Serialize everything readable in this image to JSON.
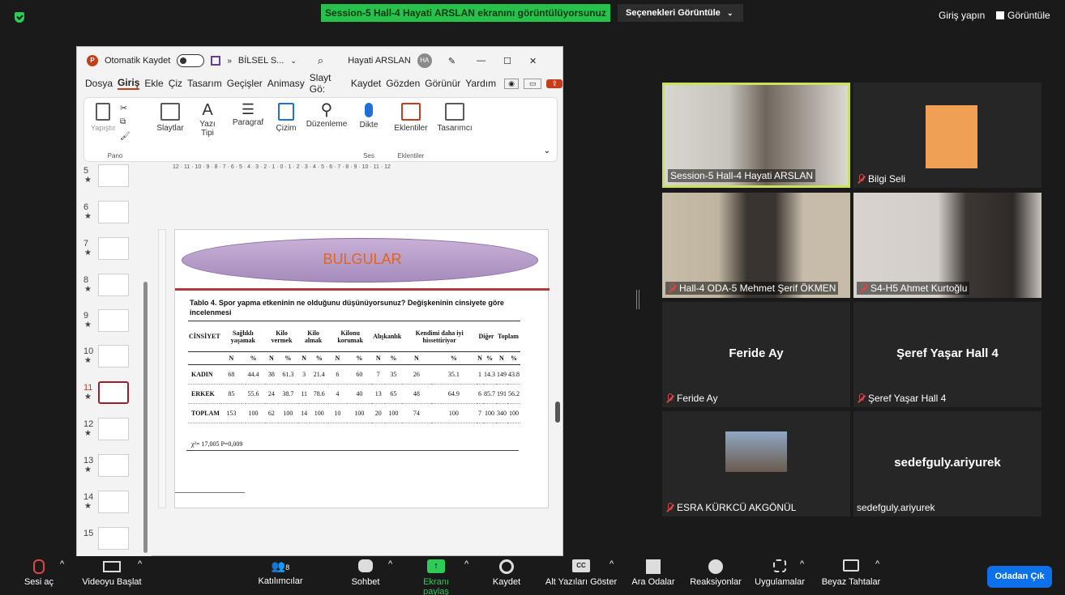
{
  "top": {
    "share_banner": "Session-5 Hall-4 Hayati ARSLAN  ekranını görüntülüyorsunuz",
    "options": "Seçenekleri Görüntüle",
    "signin": "Giriş yapın",
    "view": "Görüntüle"
  },
  "ppt": {
    "autosave": "Otomatik Kaydet",
    "filename": "BİLSEL S...",
    "user": "Hayati ARSLAN",
    "user_initials": "HA",
    "menu": [
      "Dosya",
      "Giriş",
      "Ekle",
      "Çiz",
      "Tasarım",
      "Geçişler",
      "Animasy",
      "Slayt Gö:",
      "Kaydet",
      "Gözden",
      "Görünür",
      "Yardım"
    ],
    "ribbon": {
      "paste": "Yapıştır",
      "clipboard_group": "Pano",
      "slides": "Slaytlar",
      "font": "Yazı Tipi",
      "paragraph": "Paragraf",
      "drawing": "Çizim",
      "editing": "Düzenleme",
      "dictate": "Dikte",
      "voice_group": "Ses",
      "addins": "Eklentiler",
      "addins_group": "Eklentiler",
      "designer": "Tasarımcı"
    },
    "thumbnail_numbers": [
      "5",
      "6",
      "7",
      "8",
      "9",
      "10",
      "11",
      "12",
      "13",
      "14",
      "15"
    ],
    "ruler": "12 · 11 · 10 · 9 · 8 · 7 · 6 · 5 · 4 · 3 · 2 · 1 · 0 · 1 · 2 · 3 · 4 · 5 · 6 · 7 · 8 · 9 · 10 · 11 · 12"
  },
  "slide": {
    "heading": "BULGULAR",
    "table_title": "Tablo 4. Spor yapma etkeninin ne olduğunu düşünüyorsunuz? Değişkeninin cinsiyete göre incelenmesi",
    "col_main": "CİNSİYET",
    "groups": [
      "Sağlıklı yaşamak",
      "Kilo vermek",
      "Kilo almak",
      "Kilonu korumak",
      "Alışkanlık",
      "Kendimi daha iyi hissettiriyor",
      "Diğer",
      "Toplam"
    ],
    "sub": [
      "N",
      "%",
      "N",
      "%",
      "N",
      "%",
      "N",
      "%",
      "N",
      "%",
      "N",
      "%",
      "N",
      "%",
      "N",
      "%"
    ],
    "rows": [
      {
        "label": "KADIN",
        "vals": [
          "68",
          "44.4",
          "38",
          "61.3",
          "3",
          "21.4",
          "6",
          "60",
          "7",
          "35",
          "26",
          "35.1",
          "1",
          "14.3",
          "149",
          "43.8"
        ]
      },
      {
        "label": "ERKEK",
        "vals": [
          "85",
          "55.6",
          "24",
          "38.7",
          "11",
          "78.6",
          "4",
          "40",
          "13",
          "65",
          "48",
          "64.9",
          "6",
          "85.7",
          "191",
          "56.2"
        ]
      },
      {
        "label": "TOPLAM",
        "vals": [
          "153",
          "100",
          "62",
          "100",
          "14",
          "100",
          "10",
          "100",
          "20",
          "100",
          "74",
          "100",
          "7",
          "100",
          "340",
          "100"
        ]
      }
    ],
    "chi": "χ²= 17,005 P=0,009"
  },
  "participants": [
    {
      "name": "Session-5 Hall-4 Hayati ARSLAN",
      "muted": false,
      "active": true
    },
    {
      "name": "Bilgi Seli",
      "muted": true
    },
    {
      "name": "Hall-4 ODA-5 Mehmet Şerif ÖKMEN",
      "muted": true
    },
    {
      "name": "S4-H5 Ahmet Kurtoğlu",
      "muted": true
    },
    {
      "name": "Feride Ay",
      "display": "Feride Ay",
      "muted": true
    },
    {
      "name": "Şeref Yaşar Hall 4",
      "display": "Şeref Yaşar Hall 4",
      "muted": true
    },
    {
      "name": "ESRA KÜRKCÜ AKGÖNÜL",
      "muted": true
    },
    {
      "name": "sedefguly.ariyurek",
      "display": "sedefguly.ariyurek",
      "muted": false
    }
  ],
  "toolbar": {
    "unmute": "Sesi aç",
    "video": "Videoyu Başlat",
    "participants": "Katılımcılar",
    "participants_count": "8",
    "chat": "Sohbet",
    "share": "Ekranı paylaş",
    "record": "Kaydet",
    "captions": "Alt Yazıları Göster",
    "captions_icon": "CC",
    "breakout": "Ara Odalar",
    "reactions": "Reaksiyonlar",
    "apps": "Uygulamalar",
    "whiteboards": "Beyaz Tahtalar",
    "leave": "Odadan Çık"
  },
  "colors": {
    "share_green": "#27c24c",
    "leave_blue": "#0e71eb",
    "active_border": "#c9e25a",
    "ppt_red": "#c43e1c"
  }
}
